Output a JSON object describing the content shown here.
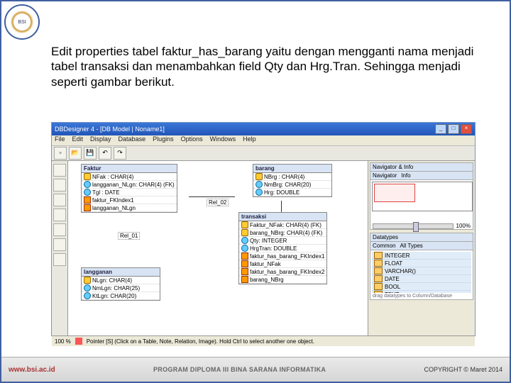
{
  "logo_text": "BSI",
  "body_text": "Edit properties tabel faktur_has_barang yaitu dengan mengganti nama menjadi tabel transaksi dan menambahkan field Qty dan Hrg.Tran. Sehingga menjadi seperti gambar berikut.",
  "app": {
    "title": "DBDesigner 4 - [DB Model | Noname1]",
    "menu": [
      "File",
      "Edit",
      "Display",
      "Database",
      "Plugins",
      "Options",
      "Windows",
      "Help"
    ],
    "tables": {
      "faktur": {
        "name": "Faktur",
        "rows": [
          "NFak : CHAR(4)",
          "langganan_NLgn: CHAR(4) (FK)",
          "Tgl : DATE",
          "faktur_FKIndex1",
          "langganan_NLgn"
        ]
      },
      "barang": {
        "name": "barang",
        "rows": [
          "NBrg : CHAR(4)",
          "NmBrg: CHAR(20)",
          "Hrg: DOUBLE"
        ]
      },
      "transaksi": {
        "name": "transaksi",
        "rows": [
          "Faktur_NFak: CHAR(4) (FK)",
          "barang_NBrg: CHAR(4) (FK)",
          "Qty: INTEGER",
          "HrgTran: DOUBLE",
          "faktur_has_barang_FKIndex1",
          "faktur_NFak",
          "faktur_has_barang_FKIndex2",
          "barang_NBrg"
        ]
      },
      "langganan": {
        "name": "langganan",
        "rows": [
          "NLgn: CHAR(4)",
          "NmLgn: CHAR(25)",
          "KtLgn: CHAR(20)"
        ]
      }
    },
    "rel1_label": "Rel_01",
    "rel2_label": "Rel_02",
    "nav": {
      "title": "Navigator & Info",
      "tabs": [
        "Navigator",
        "Info"
      ],
      "zoom": "100%"
    },
    "dt": {
      "title": "Datatypes",
      "tabs": [
        "Common",
        "All Types"
      ],
      "items": [
        "INTEGER",
        "FLOAT",
        "VARCHAR()",
        "DATE",
        "BOOL",
        "TEXT"
      ],
      "hint": "drag datatypes to Column/Database"
    },
    "status": {
      "zoom": "100 %",
      "hint": "Pointer [S] (Click on a Table, Note, Relation, Image). Hold Ctrl to select another one object."
    }
  },
  "footer": {
    "url": "www.bsi.ac.id",
    "program": "PROGRAM DIPLOMA III BINA SARANA INFORMATIKA",
    "copyright": "COPYRIGHT © Maret 2014"
  }
}
